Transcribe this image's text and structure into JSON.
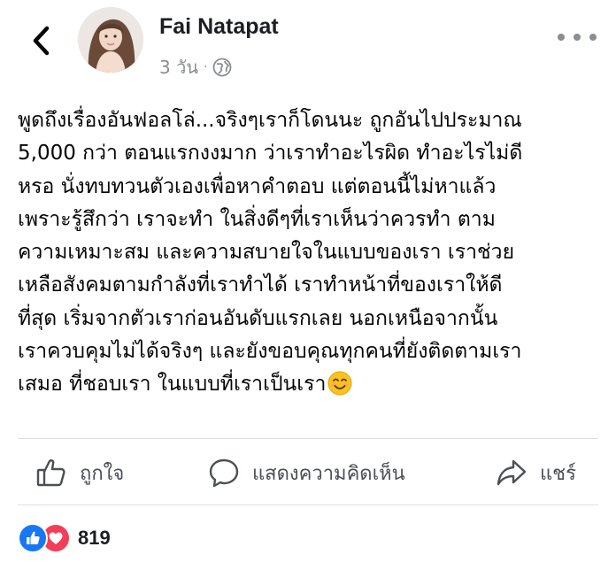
{
  "header": {
    "author_name": "Fai Natapat",
    "time": "3 วัน",
    "separator": "·",
    "privacy_icon": "globe-icon",
    "back_icon": "chevron-left-icon",
    "more_icon": "more-horizontal-icon"
  },
  "post": {
    "lines": [
      "พูดถึงเรื่องอันฟอลโล่...จริงๆเราก็โดนนะ ถูกอันไปประมาณ",
      "5,000 กว่า ตอนแรกงงมาก ว่าเราทำอะไรผิด ทำอะไรไม่ดี",
      "หรอ นั่งทบทวนตัวเองเพื่อหาคำตอบ แต่ตอนนี้ไม่หาแล้ว",
      "เพราะรู้สึกว่า เราจะทำ ในสิ่งดีๆที่เราเห็นว่าควรทำ ตาม",
      "ความเหมาะสม และความสบายใจในแบบของเรา เราช่วย",
      "เหลือสังคมตามกำลังที่เราทำได้ เราทำหน้าที่ของเราให้ดี",
      "ที่สุด เริ่มจากตัวเราก่อนอันดับแรกเลย นอกเหนือจากนั้น",
      "เราควบคุมไม่ได้จริงๆ และยังขอบคุณทุกคนที่ยังติดตามเรา",
      "เสมอ ที่ชอบเรา ในแบบที่เราเป็นเรา"
    ],
    "trailing_emoji": "smiling-face-emoji"
  },
  "actions": {
    "like": {
      "label": "ถูกใจ",
      "icon": "thumbs-up-icon"
    },
    "comment": {
      "label": "แสดงความคิดเห็น",
      "icon": "comment-icon"
    },
    "share": {
      "label": "แชร์",
      "icon": "share-icon"
    }
  },
  "reactions": {
    "icons": [
      "like-reaction-icon",
      "love-reaction-icon"
    ],
    "count": "819"
  },
  "colors": {
    "text": "#050505",
    "secondary": "#8a8d91",
    "action_text": "#4b4f56",
    "divider": "#dddfe2",
    "like_blue": "#1877f2",
    "love_red": "#f33e58"
  }
}
